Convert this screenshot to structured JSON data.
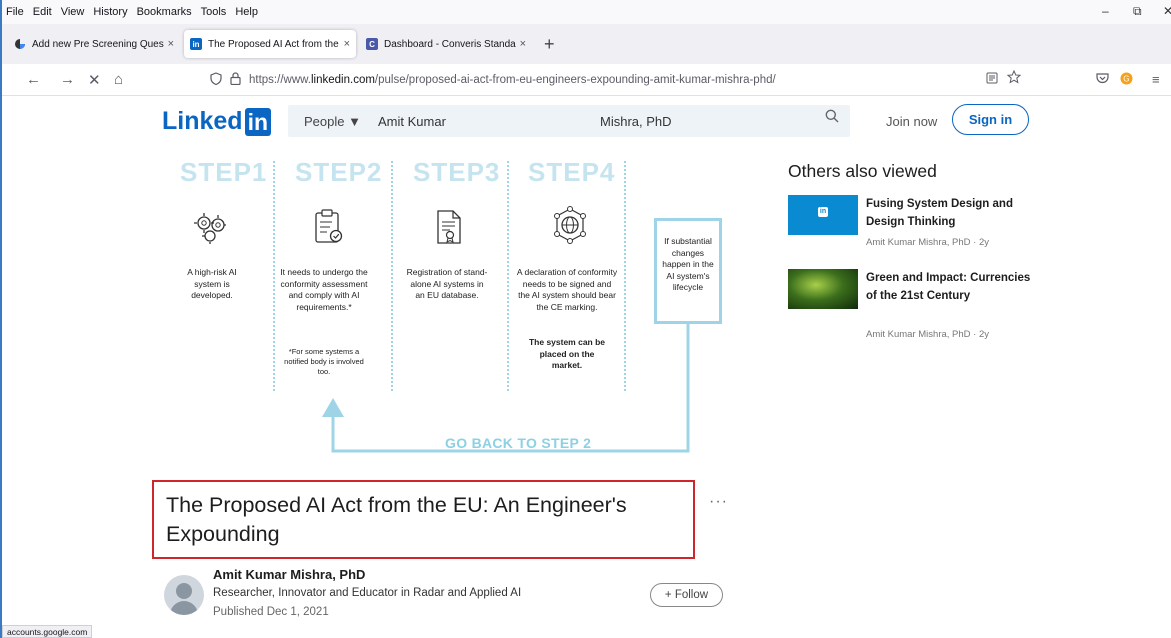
{
  "menu": [
    "File",
    "Edit",
    "View",
    "History",
    "Bookmarks",
    "Tools",
    "Help"
  ],
  "window_controls": {
    "minimize": "–",
    "restore": "⧉",
    "close": "✕"
  },
  "tabs": [
    {
      "label": "Add new Pre Screening Questio",
      "favicon": "google-icon",
      "close": "×",
      "active": false
    },
    {
      "label": "The Proposed AI Act from the E",
      "favicon": "linkedin-icon",
      "close": "×",
      "active": true
    },
    {
      "label": "Dashboard - Converis Standard",
      "favicon": "converis-icon",
      "close": "×",
      "active": false
    }
  ],
  "new_tab": "+",
  "nav": {
    "back": "←",
    "forward": "→",
    "stop": "✕",
    "home": "⌂"
  },
  "url": {
    "prefix": "https://www.",
    "host": "linkedin.com",
    "path": "/pulse/proposed-ai-act-from-eu-engineers-expounding-amit-kumar-mishra-phd/"
  },
  "linkedin": {
    "logo_text": "Linked",
    "logo_in": "in",
    "people": "People ▼",
    "search_first": "Amit Kumar",
    "search_last": "Mishra, PhD",
    "join": "Join now",
    "signin": "Sign in"
  },
  "infographic": {
    "steps": [
      "STEP1",
      "STEP2",
      "STEP3",
      "STEP4"
    ],
    "step1_text": "A high-risk AI system is developed.",
    "step2_text": "It needs to undergo the conformity assessment and comply with AI requirements.*",
    "step2_note": "*For some systems a notified body is involved too.",
    "step3_text": "Registration of stand-alone AI systems in an EU database.",
    "step4_text": "A declaration of conformity needs to be signed and the AI system should bear the CE marking.",
    "step4_bold": "The system can be placed on the market.",
    "feedback": "If substantial changes happen in the AI system's lifecycle",
    "goback": "GO BACK TO STEP 2"
  },
  "article": {
    "title": "The Proposed AI Act from the EU: An Engineer's Expounding",
    "more": "···",
    "author": "Amit Kumar Mishra, PhD",
    "bio": "Researcher, Innovator and Educator in Radar and Applied AI",
    "published": "Published Dec 1, 2021",
    "follow": "+ Follow"
  },
  "others": {
    "heading": "Others also viewed",
    "items": [
      {
        "title": "Fusing System Design and Design Thinking",
        "meta": "Amit Kumar Mishra, PhD · 2y"
      },
      {
        "title": "Green and Impact: Currencies of the 21st Century",
        "meta": "Amit Kumar Mishra, PhD · 2y"
      }
    ]
  },
  "status": "accounts.google.com",
  "colors": {
    "linkedin_blue": "#0a66c2",
    "step_heading": "#c6e4ef",
    "accent_cyan": "#9fd4e6",
    "highlight_red": "#d0262a"
  }
}
